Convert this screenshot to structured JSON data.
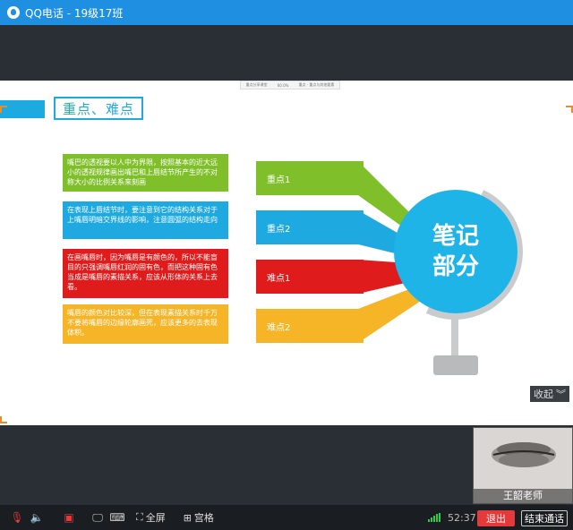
{
  "window": {
    "title": "QQ电话 - 19级17班"
  },
  "slide": {
    "top_strip": [
      "重点分享课堂",
      "60.0%",
      "重点 · 重点与其他要素"
    ],
    "heading": "重点、难点",
    "boxes": [
      {
        "text": "嘴巴的透视要以人中为界限，按照基本的近大远小的透视规律画出嘴巴和上唇结节所产生的不对称大小的比例关系来刻画",
        "color": "#7fbf2a"
      },
      {
        "text": "在表现上唇结节时，要注意到它的结构关系对于上嘴唇明暗交界线的影响，注意圆弧的结构走向",
        "color": "#1fa9e1"
      },
      {
        "text": "在画嘴唇时，因为嘴唇是有颜色的，所以不能盲目的只强调嘴唇红润的固有色，而把这种固有色当成是嘴唇的素描关系，应该从形体的关系上去看。",
        "color": "#e01b1b"
      },
      {
        "text": "嘴唇的颜色对比较深，但在表现素描关系时千万不要将嘴唇的边缘轮廓画死，应该更多的去表现体积。",
        "color": "#f6b526"
      }
    ],
    "tags": [
      {
        "label": "重点1",
        "color": "#7fbf2a"
      },
      {
        "label": "重点2",
        "color": "#1fa9e1"
      },
      {
        "label": "难点1",
        "color": "#e01b1b"
      },
      {
        "label": "难点2",
        "color": "#f6b526"
      }
    ],
    "globe": {
      "line1": "笔记",
      "line2": "部分"
    }
  },
  "collapse": {
    "label": "收起"
  },
  "thumbnail": {
    "name": "王韶老师"
  },
  "toolbar": {
    "fullscreen": "全屏",
    "grid": "宫格",
    "time": "52:37",
    "exit": "退出",
    "end_call": "结束通话"
  }
}
